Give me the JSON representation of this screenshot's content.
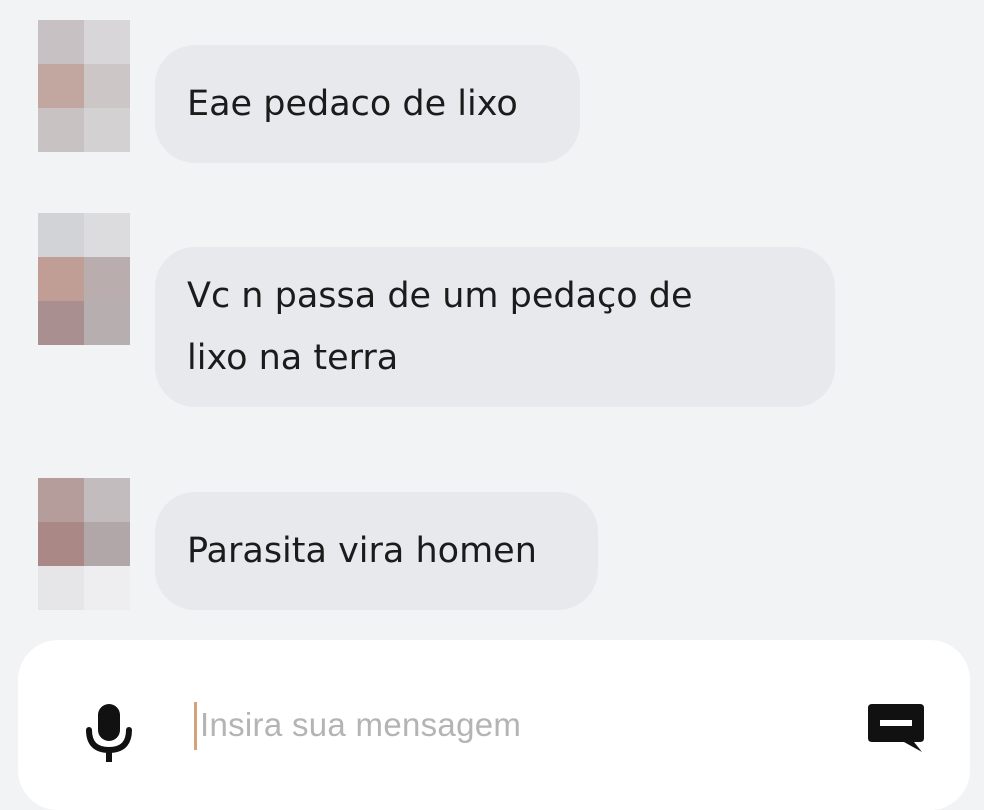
{
  "messages": [
    {
      "text": "Eae pedaco de lixo"
    },
    {
      "text_line1": "Vc n passa de um pedaço de",
      "text_line2": "lixo na terra"
    },
    {
      "text": "Parasita vira homen"
    }
  ],
  "composer": {
    "placeholder": "Insira sua mensagem",
    "mic_icon": "microphone-icon",
    "send_icon": "message-send-icon"
  }
}
